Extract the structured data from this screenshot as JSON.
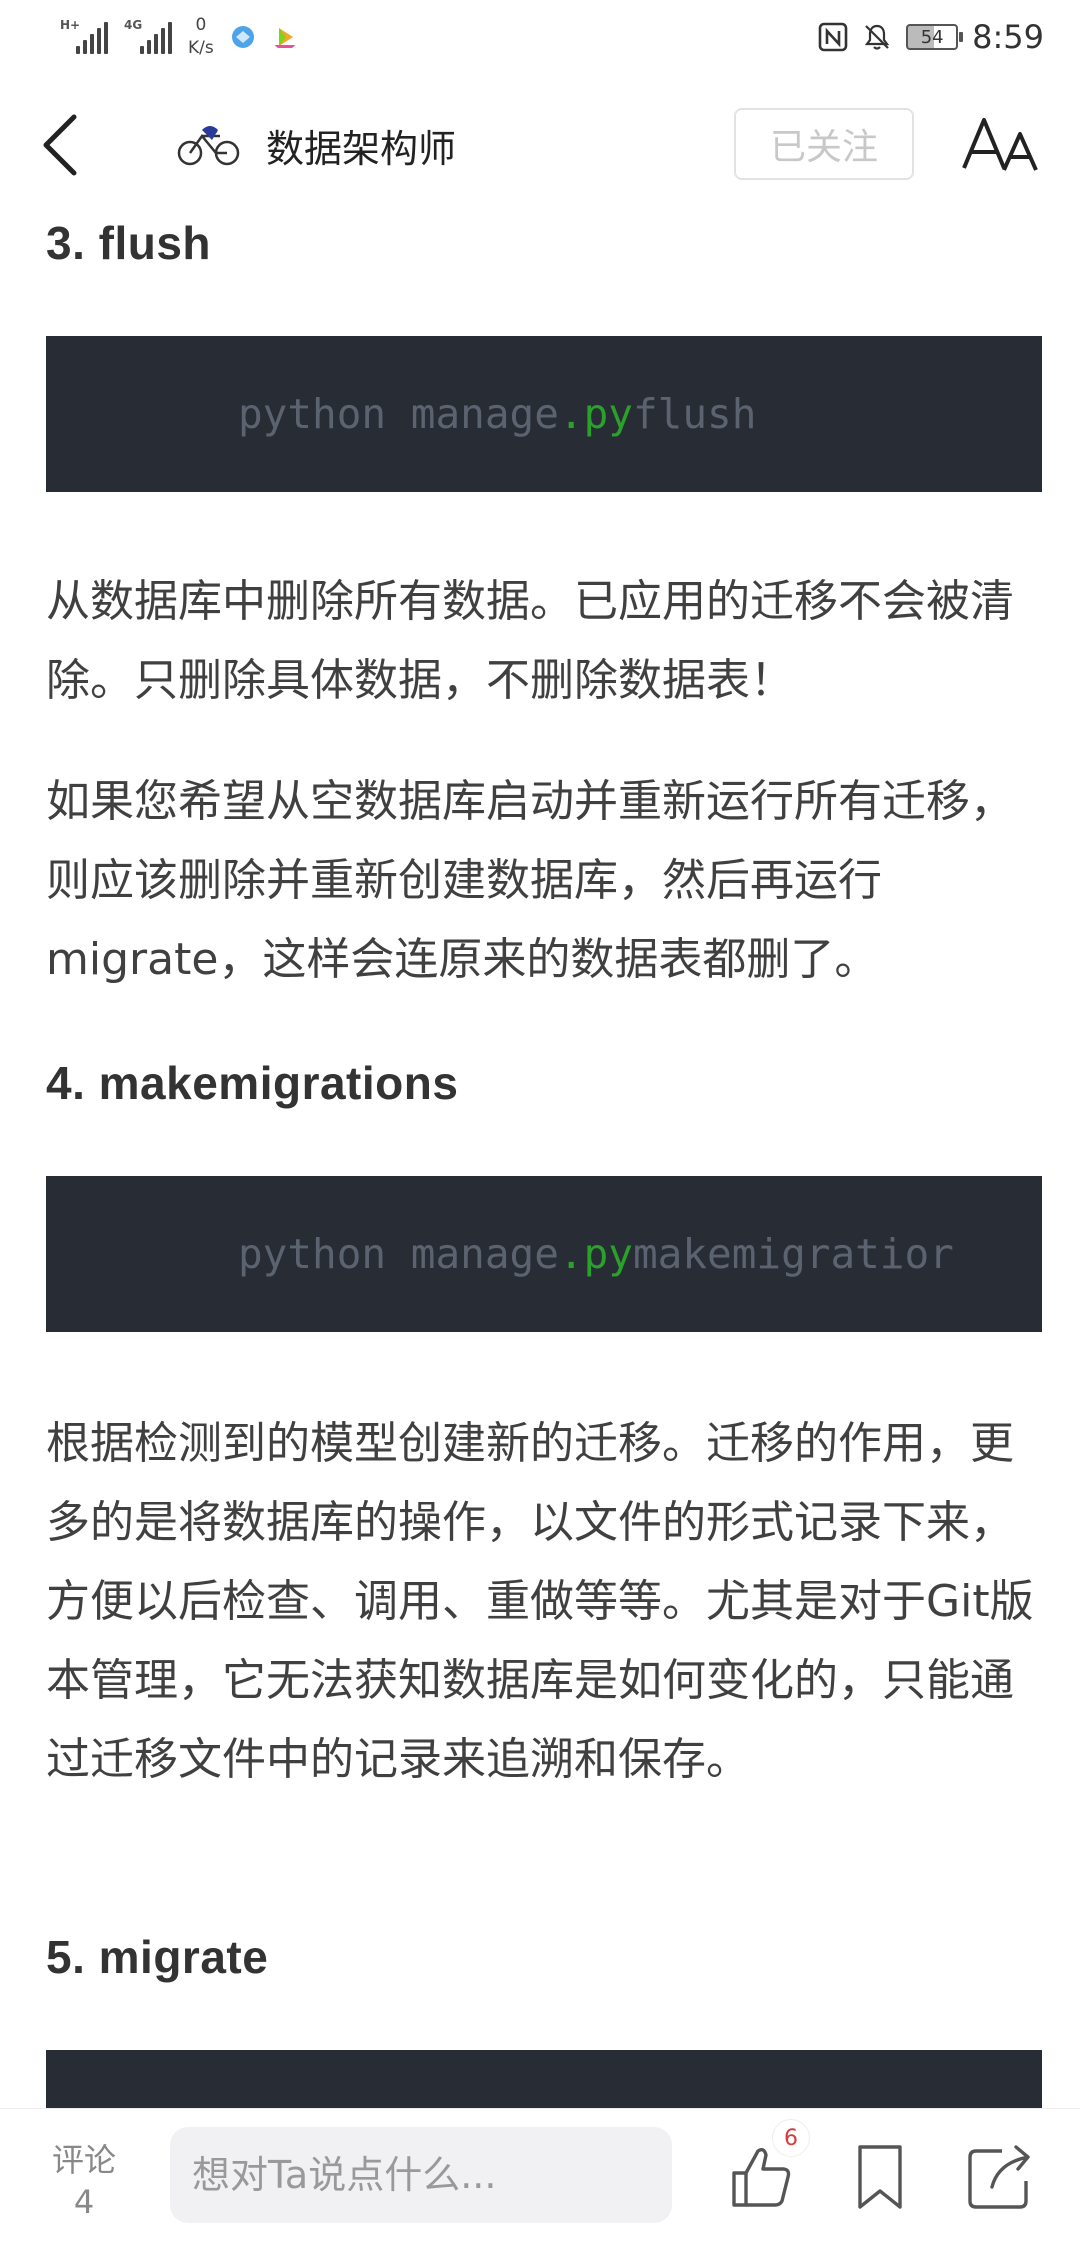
{
  "status_bar": {
    "signal_1_tag": "H+",
    "signal_2_tag": "4G",
    "net_speed_value": "0",
    "net_speed_unit": "K/s",
    "nfc_icon": "nfc-icon",
    "mute_icon": "bell-off-icon",
    "battery_level": "54",
    "time": "8:59"
  },
  "header": {
    "author_name": "数据架构师",
    "follow_label": "已关注",
    "back_icon": "chevron-left-icon",
    "font_icon": "font-size-icon"
  },
  "article": {
    "section_3": {
      "heading": "3. flush",
      "code_prefix": "python manage",
      "code_keyword": ".py",
      "code_suffix": " flush",
      "para_1": "从数据库中删除所有数据。已应用的迁移不会被清除。只删除具体数据，不删除数据表！",
      "para_2": "如果您希望从空数据库启动并重新运行所有迁移，则应该删除并重新创建数据库，然后再运行migrate，这样会连原来的数据表都删了。"
    },
    "section_4": {
      "heading": "4. makemigrations",
      "code_prefix": "python manage",
      "code_keyword": ".py",
      "code_suffix": " makemigratior",
      "para_1": "根据检测到的模型创建新的迁移。迁移的作用，更多的是将数据库的操作，以文件的形式记录下来，方便以后检查、调用、重做等等。尤其是对于Git版本管理，它无法获知数据库是如何变化的，只能通过迁移文件中的记录来追溯和保存。"
    },
    "section_5": {
      "heading": "5. migrate"
    }
  },
  "bottom_bar": {
    "comment_label": "评论",
    "comment_count": "4",
    "input_placeholder": "想对Ta说点什么...",
    "like_count": "6"
  },
  "colors": {
    "code_bg": "#282c34",
    "code_text": "#5c6370",
    "code_keyword": "#2aa12a",
    "badge_text": "#d83b3b"
  }
}
